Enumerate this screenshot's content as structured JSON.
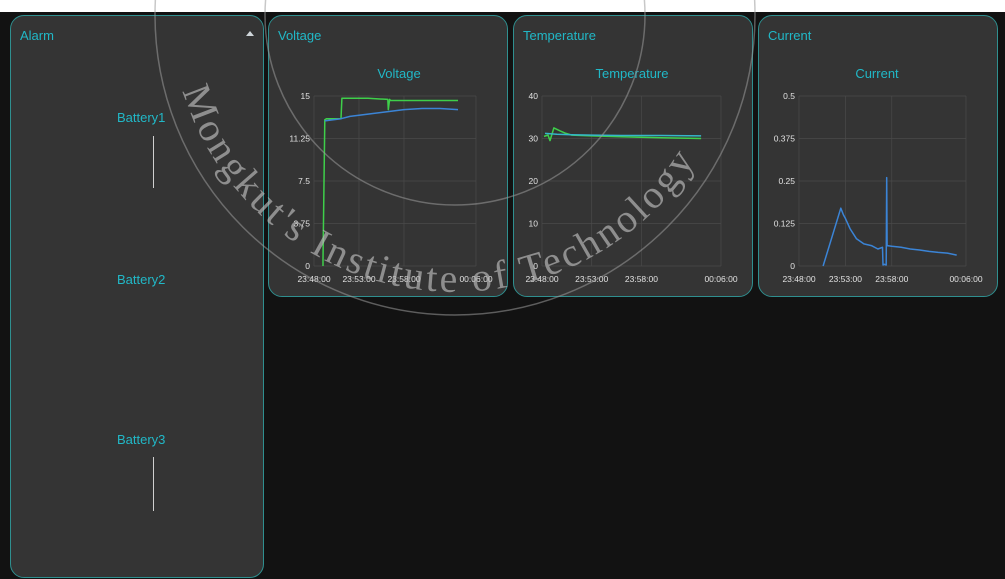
{
  "alarm": {
    "title": "Alarm",
    "batteries": [
      "Battery1",
      "Battery2",
      "Battery3"
    ]
  },
  "colors": {
    "accent": "#21b8c7",
    "panel_border": "#2f8f8f",
    "series_green": "#3ecf4a",
    "series_blue": "#3b84d6",
    "series_cyan": "#35b6c9"
  },
  "watermark": "Mongkut's Institute of Technology",
  "panels": {
    "voltage": {
      "title": "Voltage"
    },
    "temperature": {
      "title": "Temperature"
    },
    "current": {
      "title": "Current"
    }
  },
  "chart_data": [
    {
      "id": "voltage",
      "type": "line",
      "title": "Voltage",
      "ylim": [
        0,
        15
      ],
      "yticks": [
        "0",
        "3.75",
        "7.5",
        "11.25",
        "15"
      ],
      "xlim_min": [
        0,
        18
      ],
      "xticks": [
        {
          "m": 0,
          "label": "23:48:00"
        },
        {
          "m": 5,
          "label": "23:53:00"
        },
        {
          "m": 10,
          "label": "23:58:00"
        },
        {
          "m": 18,
          "label": "00:06:00"
        }
      ],
      "grid": true,
      "series": [
        {
          "color": "#3ecf4a",
          "x": [
            1.0,
            1.0,
            1.2,
            1.4,
            3.0,
            3.1,
            3.3,
            6.0,
            8.2,
            8.25,
            8.4,
            8.5,
            12,
            16
          ],
          "y": [
            0,
            0.5,
            12.9,
            13.0,
            13.0,
            14.8,
            14.8,
            14.8,
            14.7,
            13.8,
            14.7,
            14.6,
            14.6,
            14.6
          ]
        },
        {
          "color": "#3b84d6",
          "x": [
            1.2,
            3,
            4,
            6,
            8,
            10,
            12,
            14,
            16
          ],
          "y": [
            12.8,
            13.0,
            13.2,
            13.4,
            13.6,
            13.8,
            13.9,
            13.9,
            13.8
          ]
        }
      ]
    },
    {
      "id": "temperature",
      "type": "line",
      "title": "Temperature",
      "ylim": [
        0,
        40
      ],
      "yticks": [
        "0",
        "10",
        "20",
        "30",
        "40"
      ],
      "xlim_min": [
        0,
        18
      ],
      "xticks": [
        {
          "m": 0,
          "label": "23:48:00"
        },
        {
          "m": 5,
          "label": "23:53:00"
        },
        {
          "m": 10,
          "label": "23:58:00"
        },
        {
          "m": 18,
          "label": "00:06:00"
        }
      ],
      "grid": true,
      "series": [
        {
          "color": "#3ecf4a",
          "x": [
            0.2,
            0.6,
            0.8,
            1.2,
            1.8,
            2.4,
            3,
            5,
            8,
            12,
            16
          ],
          "y": [
            30.5,
            30.8,
            29.5,
            32.5,
            31.8,
            31.2,
            30.8,
            30.6,
            30.4,
            30.2,
            30.0
          ]
        },
        {
          "color": "#35b6c9",
          "x": [
            0.3,
            1.5,
            3,
            5,
            8,
            12,
            16
          ],
          "y": [
            31.2,
            31.0,
            30.9,
            30.8,
            30.7,
            30.7,
            30.6
          ]
        }
      ]
    },
    {
      "id": "current",
      "type": "line",
      "title": "Current",
      "ylim": [
        0,
        0.5
      ],
      "yticks": [
        "0",
        "0.125",
        "0.25",
        "0.375",
        "0.5"
      ],
      "xlim_min": [
        0,
        18
      ],
      "xticks": [
        {
          "m": 0,
          "label": "23:48:00"
        },
        {
          "m": 5,
          "label": "23:53:00"
        },
        {
          "m": 10,
          "label": "23:58:00"
        },
        {
          "m": 18,
          "label": "00:06:00"
        }
      ],
      "grid": true,
      "series": [
        {
          "color": "#3b84d6",
          "x": [
            2.6,
            4.5,
            4.8,
            5.0,
            5.5,
            6.2,
            7,
            7.8,
            8.5,
            9.0,
            9.05,
            9.2,
            9.4,
            9.45,
            9.5,
            10,
            11,
            12,
            13,
            14,
            15,
            16,
            17
          ],
          "y": [
            0,
            0.17,
            0.15,
            0.14,
            0.11,
            0.08,
            0.065,
            0.06,
            0.05,
            0.055,
            0.003,
            0.005,
            0.003,
            0.26,
            0.06,
            0.058,
            0.055,
            0.05,
            0.047,
            0.043,
            0.04,
            0.038,
            0.032
          ]
        }
      ]
    }
  ]
}
